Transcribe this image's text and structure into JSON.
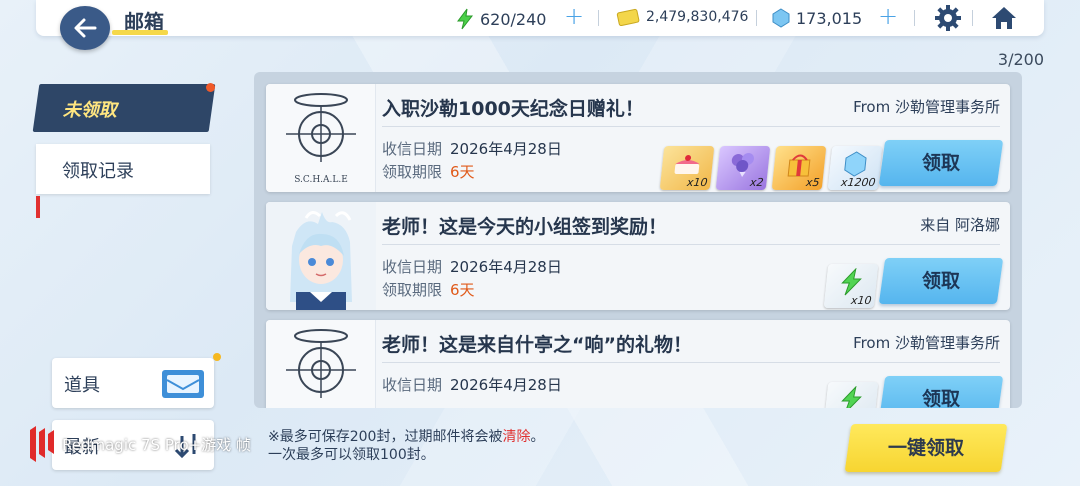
{
  "header": {
    "title": "邮箱",
    "ap": "620/240",
    "credits": "2,479,830,476",
    "pyroxene": "173,015"
  },
  "mail_count": "3/200",
  "tabs": {
    "unclaimed": "未领取",
    "history": "领取记录"
  },
  "side_buttons": {
    "items": "道具",
    "refresh": "最新"
  },
  "watermark": "Redmagic 7S Pro+游戏 帧",
  "mails": [
    {
      "title": "入职沙勒1000天纪念日赠礼！",
      "from": "From 沙勒管理事务所",
      "date_label": "收信日期",
      "date": "2026年4月28日",
      "expire_label": "领取期限",
      "expire": "6天",
      "sender_caption": "S.C.H.A.L.E",
      "rewards": [
        {
          "icon": "cake-icon",
          "qty": "x10",
          "color": "#f5c84a"
        },
        {
          "icon": "bouquet-icon",
          "qty": "x2",
          "color": "#b08ae8"
        },
        {
          "icon": "gift-box-icon",
          "qty": "x5",
          "color": "#f5b33a"
        },
        {
          "icon": "pyroxene-icon",
          "qty": "x1200",
          "color": "#d8eaf8"
        }
      ],
      "claim": "领取"
    },
    {
      "title": "老师！这是今天的小组签到奖励！",
      "from": "来自 阿洛娜",
      "date_label": "收信日期",
      "date": "2026年4月28日",
      "expire_label": "领取期限",
      "expire": "6天",
      "rewards": [
        {
          "icon": "ap-bolt-icon",
          "qty": "x10",
          "color": "#e6eef5"
        }
      ],
      "claim": "领取"
    },
    {
      "title": "老师！这是来自什亭之“响”的礼物！",
      "from": "From 沙勒管理事务所",
      "date_label": "收信日期",
      "date": "2026年4月28日",
      "rewards": [
        {
          "icon": "ap-bolt-icon",
          "qty": "",
          "color": "#e6eef5"
        }
      ],
      "claim": "领取"
    }
  ],
  "note": {
    "line1_a": "※最多可保存200封，过期邮件将会被",
    "line1_red": "清除",
    "line1_b": "。",
    "line2": "一次最多可以领取100封。"
  },
  "claim_all": "一键领取"
}
